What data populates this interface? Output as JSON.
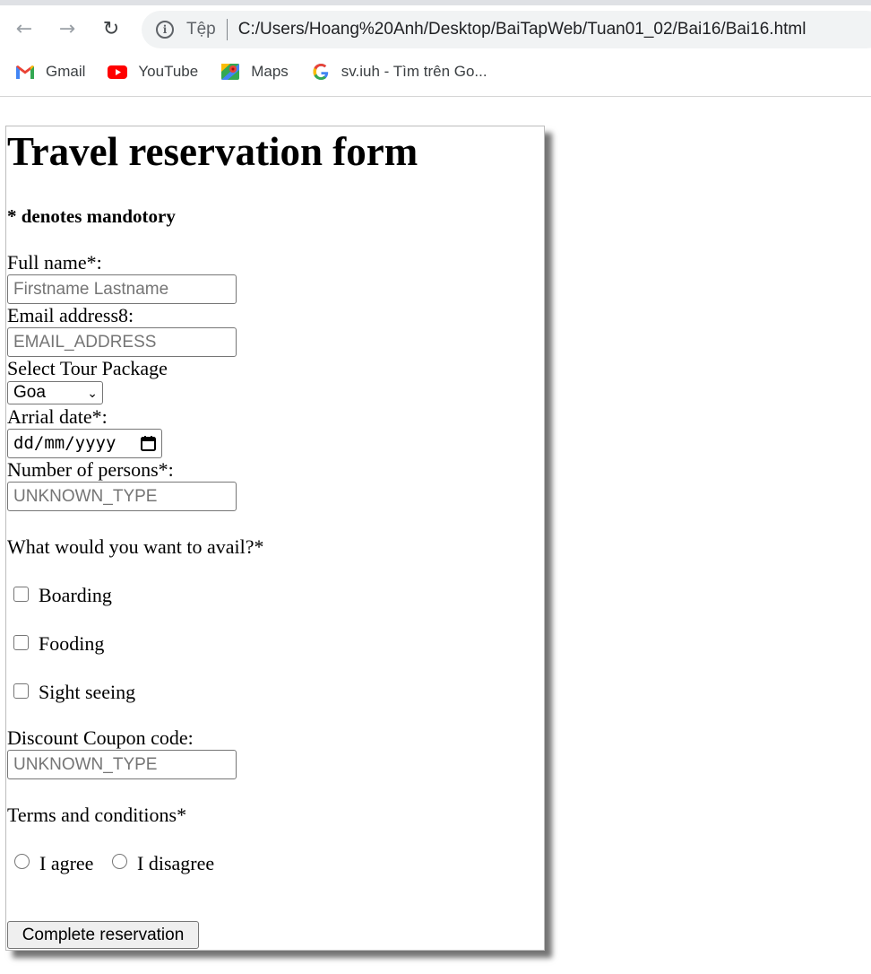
{
  "browser": {
    "address_scheme": "Tệp",
    "address_url": "C:/Users/Hoang%20Anh/Desktop/BaiTapWeb/Tuan01_02/Bai16/Bai16.html",
    "bookmarks": [
      {
        "label": "Gmail",
        "icon": "gmail-icon"
      },
      {
        "label": "YouTube",
        "icon": "youtube-icon"
      },
      {
        "label": "Maps",
        "icon": "maps-icon"
      },
      {
        "label": "sv.iuh - Tìm trên Go...",
        "icon": "google-icon"
      }
    ]
  },
  "form": {
    "title": "Travel reservation form",
    "mandatory_note": "* denotes mandotory",
    "full_name": {
      "label": "Full name*:",
      "placeholder": "Firstname Lastname",
      "value": ""
    },
    "email": {
      "label": "Email address8:",
      "placeholder": "EMAIL_ADDRESS",
      "value": ""
    },
    "tour_package": {
      "label": "Select Tour Package",
      "selected": "Goa"
    },
    "arrival_date": {
      "label": "Arrial date*:",
      "placeholder": "dd/mm/yyyy"
    },
    "persons": {
      "label": "Number of persons*:",
      "placeholder": "UNKNOWN_TYPE"
    },
    "avail": {
      "question": "What would you want to avail?*",
      "options": [
        {
          "label": "Boarding",
          "checked": false
        },
        {
          "label": "Fooding",
          "checked": false
        },
        {
          "label": "Sight seeing",
          "checked": false
        }
      ]
    },
    "coupon": {
      "label": "Discount Coupon code:",
      "placeholder": "UNKNOWN_TYPE"
    },
    "terms": {
      "label": "Terms and conditions*",
      "options": [
        {
          "label": "I agree",
          "selected": false
        },
        {
          "label": "I disagree",
          "selected": false
        }
      ]
    },
    "submit_label": "Complete reservation"
  }
}
